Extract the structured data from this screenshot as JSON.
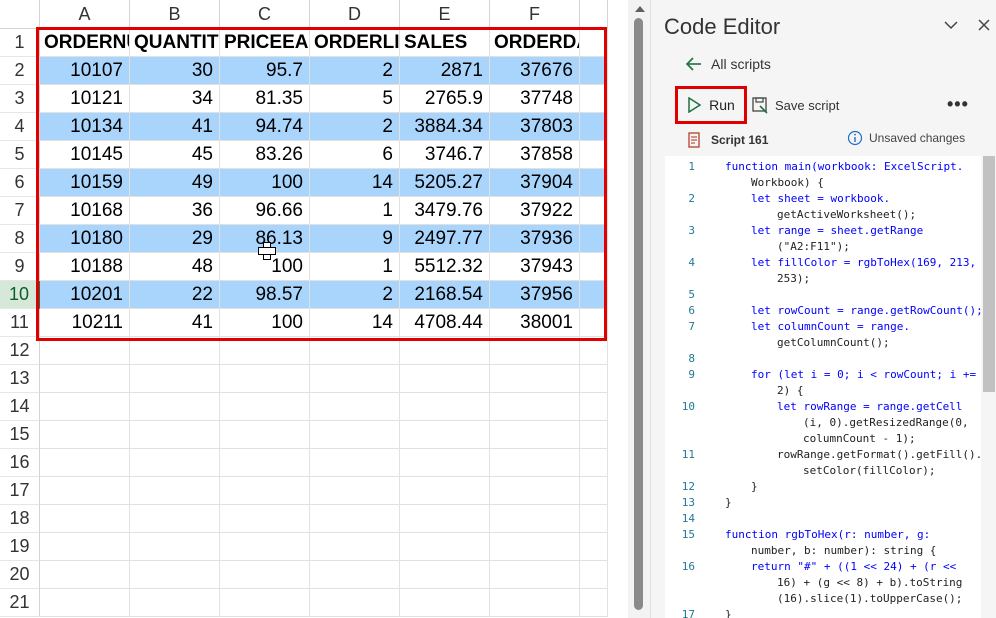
{
  "sheet": {
    "columns": [
      "A",
      "B",
      "C",
      "D",
      "E",
      "F"
    ],
    "row_numbers": [
      "1",
      "2",
      "3",
      "4",
      "5",
      "6",
      "7",
      "8",
      "9",
      "10",
      "11",
      "12",
      "13",
      "14",
      "15",
      "16",
      "17",
      "18",
      "19",
      "20",
      "21"
    ],
    "headers": [
      "ORDERNUMBER",
      "QUANTITYORDERED",
      "PRICEEACH",
      "ORDERLINENUMBER",
      "SALES",
      "ORDERDATE"
    ],
    "rows": [
      [
        "10107",
        "30",
        "95.7",
        "2",
        "2871",
        "37676"
      ],
      [
        "10121",
        "34",
        "81.35",
        "5",
        "2765.9",
        "37748"
      ],
      [
        "10134",
        "41",
        "94.74",
        "2",
        "3884.34",
        "37803"
      ],
      [
        "10145",
        "45",
        "83.26",
        "6",
        "3746.7",
        "37858"
      ],
      [
        "10159",
        "49",
        "100",
        "14",
        "5205.27",
        "37904"
      ],
      [
        "10168",
        "36",
        "96.66",
        "1",
        "3479.76",
        "37922"
      ],
      [
        "10180",
        "29",
        "86.13",
        "9",
        "2497.77",
        "37936"
      ],
      [
        "10188",
        "48",
        "100",
        "1",
        "5512.32",
        "37943"
      ],
      [
        "10201",
        "22",
        "98.57",
        "2",
        "2168.54",
        "37956"
      ],
      [
        "10211",
        "41",
        "100",
        "14",
        "4708.44",
        "38001"
      ]
    ],
    "band_color": "#a9d5fd",
    "selection_color": "#e00000"
  },
  "pane": {
    "title": "Code Editor",
    "back_label": "All scripts",
    "run_label": "Run",
    "save_label": "Save script",
    "more_label": "•••",
    "script_name": "Script 161",
    "unsaved_label": "Unsaved changes",
    "icons": {
      "chevron": "chevron-down-icon",
      "close": "close-icon",
      "back": "arrow-left-icon",
      "run": "play-icon",
      "save": "save-icon",
      "script": "script-icon",
      "info": "info-icon"
    }
  },
  "code": {
    "lines": [
      {
        "n": "1",
        "text": "function main(workbook: ExcelScript.",
        "indent": 0
      },
      {
        "n": "",
        "text": "Workbook) {",
        "indent": 1
      },
      {
        "n": "2",
        "text": "let sheet = workbook.",
        "indent": 1
      },
      {
        "n": "",
        "text": "getActiveWorksheet();",
        "indent": 2
      },
      {
        "n": "3",
        "text": "let range = sheet.getRange",
        "indent": 1
      },
      {
        "n": "",
        "text": "(\"A2:F11\");",
        "indent": 2
      },
      {
        "n": "4",
        "text": "let fillColor = rgbToHex(169, 213,",
        "indent": 1
      },
      {
        "n": "",
        "text": "253);",
        "indent": 2
      },
      {
        "n": "5",
        "text": "",
        "indent": 0
      },
      {
        "n": "6",
        "text": "let rowCount = range.getRowCount();",
        "indent": 1
      },
      {
        "n": "7",
        "text": "let columnCount = range.",
        "indent": 1
      },
      {
        "n": "",
        "text": "getColumnCount();",
        "indent": 2
      },
      {
        "n": "8",
        "text": "",
        "indent": 0
      },
      {
        "n": "9",
        "text": "for (let i = 0; i < rowCount; i +=",
        "indent": 1
      },
      {
        "n": "",
        "text": "2) {",
        "indent": 2
      },
      {
        "n": "10",
        "text": "let rowRange = range.getCell",
        "indent": 2
      },
      {
        "n": "",
        "text": "(i, 0).getResizedRange(0,",
        "indent": 3
      },
      {
        "n": "",
        "text": "columnCount - 1);",
        "indent": 3
      },
      {
        "n": "11",
        "text": "rowRange.getFormat().getFill().",
        "indent": 2
      },
      {
        "n": "",
        "text": "setColor(fillColor);",
        "indent": 3
      },
      {
        "n": "12",
        "text": "}",
        "indent": 1
      },
      {
        "n": "13",
        "text": "}",
        "indent": 0
      },
      {
        "n": "14",
        "text": "",
        "indent": 0
      },
      {
        "n": "15",
        "text": "function rgbToHex(r: number, g:",
        "indent": 0
      },
      {
        "n": "",
        "text": "number, b: number): string {",
        "indent": 1
      },
      {
        "n": "16",
        "text": "return \"#\" + ((1 << 24) + (r <<",
        "indent": 1
      },
      {
        "n": "",
        "text": "16) + (g << 8) + b).toString",
        "indent": 2
      },
      {
        "n": "",
        "text": "(16).slice(1).toUpperCase();",
        "indent": 2
      },
      {
        "n": "17",
        "text": "}",
        "indent": 0
      }
    ]
  }
}
